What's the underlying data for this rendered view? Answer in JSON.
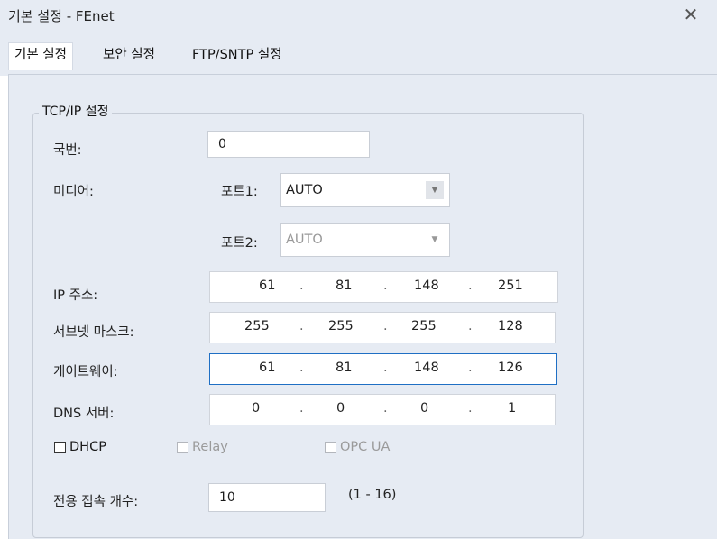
{
  "window": {
    "title": "기본 설정 - FEnet",
    "close_glyph": "✕"
  },
  "tabs": [
    "기본 설정",
    "보안 설정",
    "FTP/SNTP 설정"
  ],
  "group": {
    "title": "TCP/IP 설정"
  },
  "station": {
    "label": "국번:",
    "value": "0"
  },
  "media": {
    "label": "미디어:",
    "port1": {
      "label": "포트1:",
      "value": "AUTO",
      "enabled": true
    },
    "port2": {
      "label": "포트2:",
      "value": "AUTO",
      "enabled": false
    }
  },
  "ip": {
    "label": "IP 주소:",
    "octets": [
      "61",
      "81",
      "148",
      "251"
    ]
  },
  "subnet": {
    "label": "서브넷 마스크:",
    "octets": [
      "255",
      "255",
      "255",
      "128"
    ]
  },
  "gateway": {
    "label": "게이트웨이:",
    "octets": [
      "61",
      "81",
      "148",
      "126"
    ]
  },
  "dns": {
    "label": "DNS 서버:",
    "octets": [
      "0",
      "0",
      "0",
      "1"
    ]
  },
  "ip_separator": ".",
  "checks": {
    "dhcp": {
      "label": "DHCP",
      "checked": false,
      "enabled": true
    },
    "relay": {
      "label": "Relay",
      "checked": false,
      "enabled": false
    },
    "opcua": {
      "label": "OPC UA",
      "checked": false,
      "enabled": false
    }
  },
  "connections": {
    "label": "전용 접속 개수:",
    "value": "10",
    "range": "(1 - 16)"
  },
  "icons": {
    "close": "close-icon",
    "dropdown": "chevron-down-icon"
  }
}
